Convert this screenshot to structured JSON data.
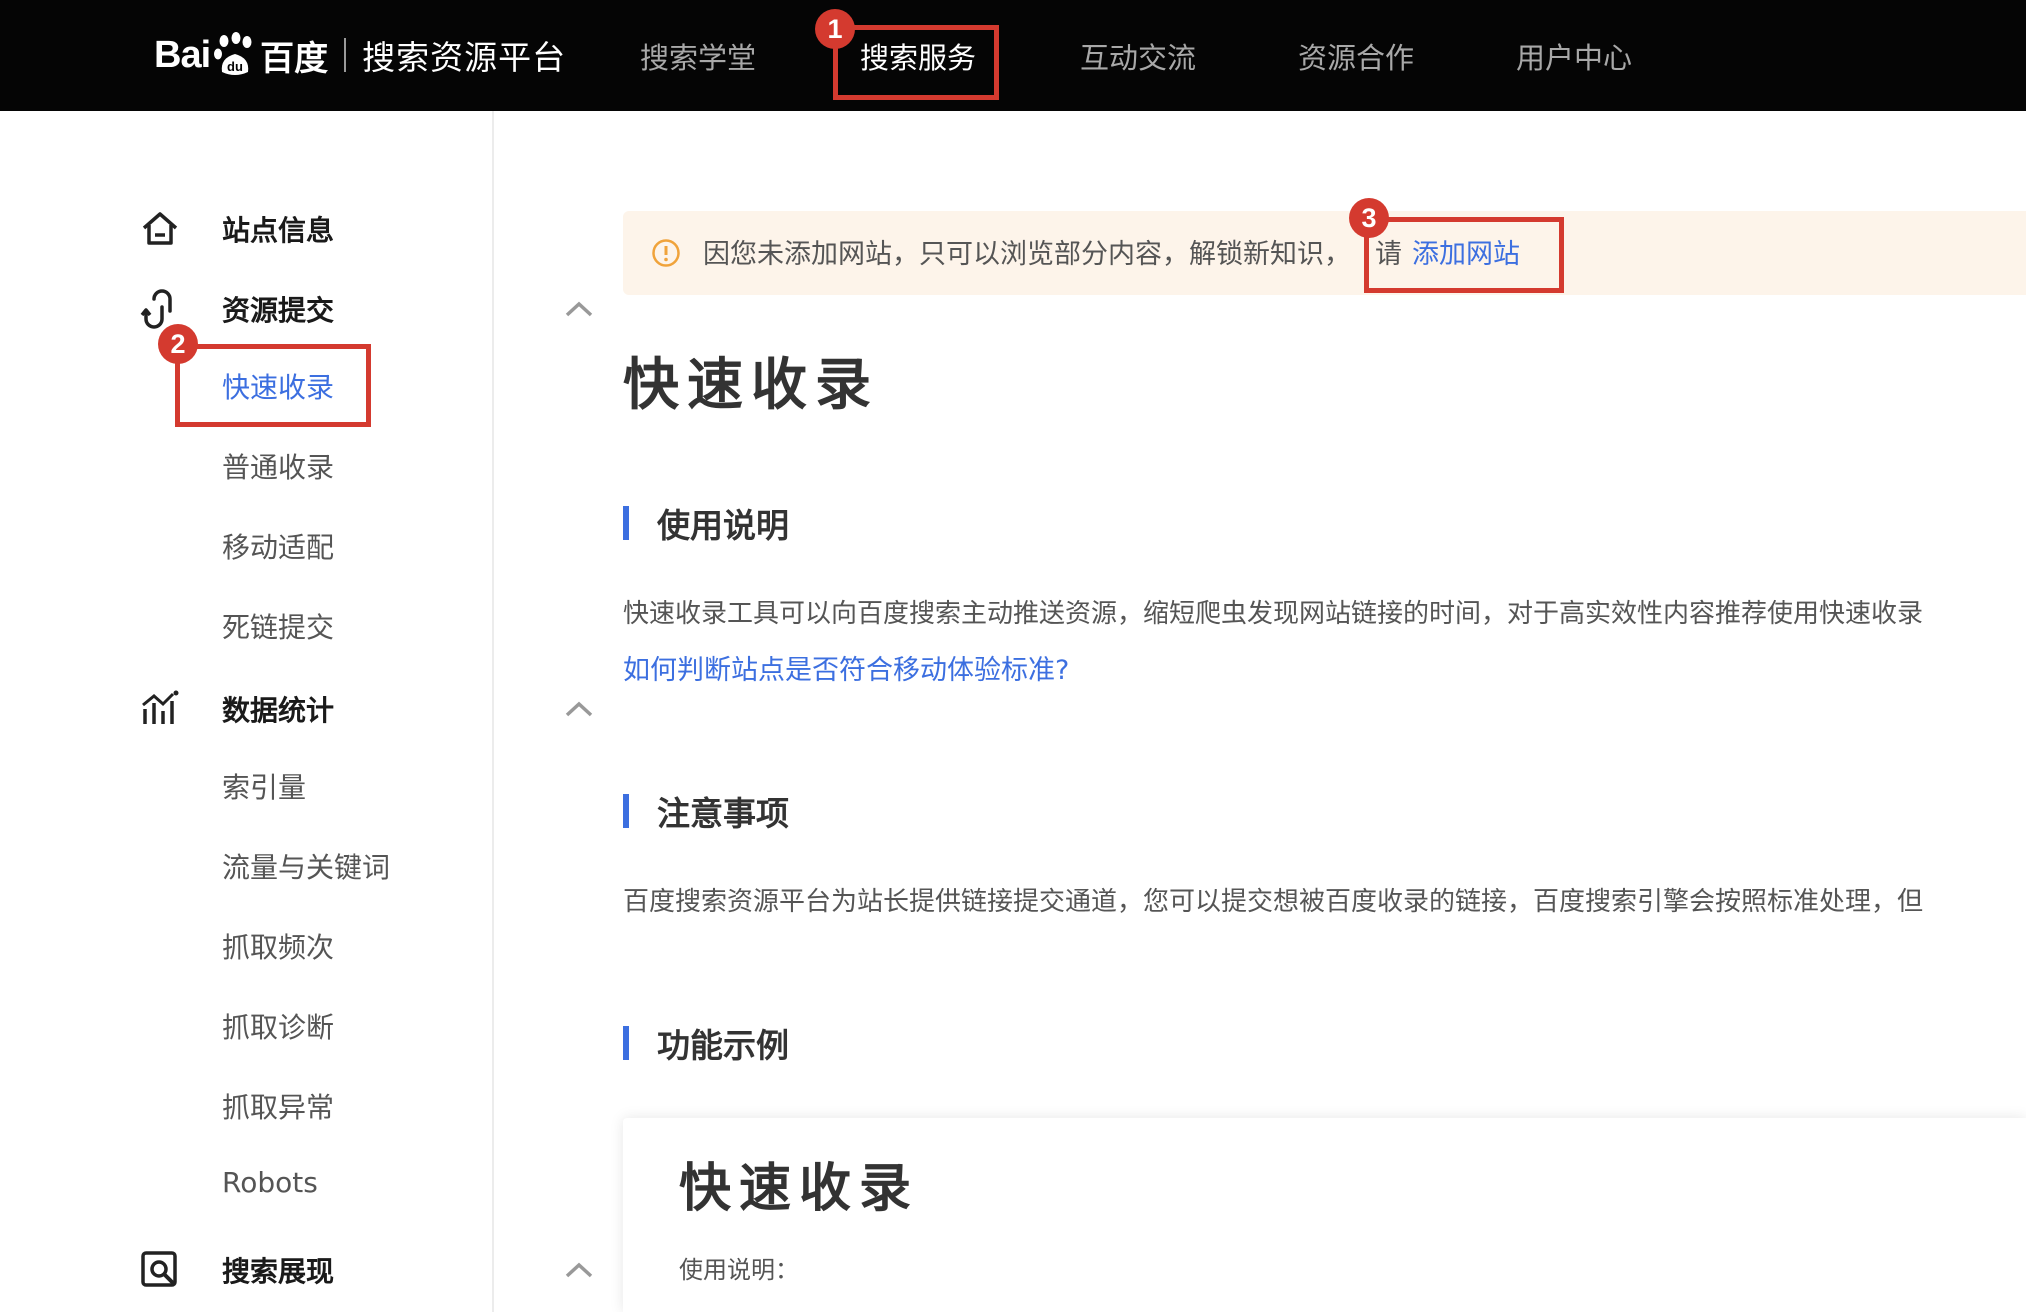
{
  "header": {
    "logo_text": "Bai",
    "logo_text_cn": "百度",
    "platform_name": "搜索资源平台",
    "nav": [
      "搜索学堂",
      "搜索服务",
      "互动交流",
      "资源合作",
      "用户中心"
    ]
  },
  "annotations": [
    "1",
    "2",
    "3"
  ],
  "sidebar": {
    "sections": [
      {
        "label": "站点信息",
        "icon": "home-icon"
      },
      {
        "label": "资源提交",
        "icon": "link-submit-icon",
        "items": [
          "快速收录",
          "普通收录",
          "移动适配",
          "死链提交"
        ]
      },
      {
        "label": "数据统计",
        "icon": "chart-icon",
        "items": [
          "索引量",
          "流量与关键词",
          "抓取频次",
          "抓取诊断",
          "抓取异常",
          "Robots"
        ]
      },
      {
        "label": "搜索展现",
        "icon": "search-display-icon"
      }
    ]
  },
  "notice": {
    "text": "因您未添加网站，只可以浏览部分内容，解锁新知识，",
    "please": "请",
    "link": "添加网站"
  },
  "main": {
    "title": "快速收录",
    "usage_heading": "使用说明",
    "usage_text": "快速收录工具可以向百度搜索主动推送资源，缩短爬虫发现网站链接的时间，对于高实效性内容推荐使用快速收录",
    "usage_link": "如何判断站点是否符合移动体验标准?",
    "notes_heading": "注意事项",
    "notes_text": "百度搜索资源平台为站长提供链接提交通道，您可以提交想被百度收录的链接，百度搜索引擎会按照标准处理，但",
    "example_heading": "功能示例",
    "card_title": "快速收录",
    "card_sub": "使用说明："
  },
  "colors": {
    "accent": "#3c6fe0",
    "annotation_red": "#d43a2f",
    "topbar": "#050505",
    "notice_bg": "#fdf4ea"
  }
}
